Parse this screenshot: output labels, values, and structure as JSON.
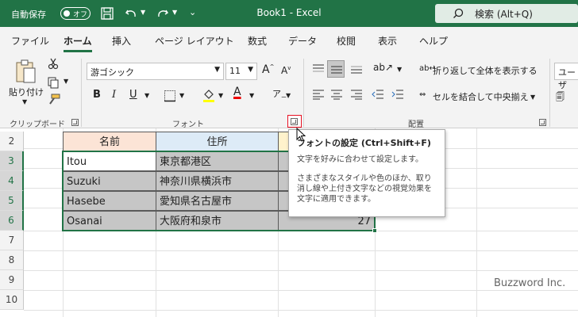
{
  "titlebar": {
    "autosave_label": "自動保存",
    "autosave_state": "オフ",
    "title": "Book1  -  Excel",
    "search_label": "検索 (Alt+Q)"
  },
  "menu": {
    "tabs": [
      "ファイル",
      "ホーム",
      "挿入",
      "ページ レイアウト",
      "数式",
      "データ",
      "校閲",
      "表示",
      "ヘルプ"
    ],
    "active": "ホーム"
  },
  "ribbon": {
    "clipboard": {
      "paste_label": "貼り付け",
      "group_label": "クリップボード"
    },
    "font": {
      "font_name": "游ゴシック",
      "font_size": "11",
      "bold": "B",
      "italic": "I",
      "underline": "U",
      "group_label": "フォント"
    },
    "alignment": {
      "wrap_label": "折り返して全体を表示する",
      "merge_label": "セルを結合して中央揃え",
      "group_label": "配置"
    },
    "number": {
      "format_partial": "ユーザ"
    }
  },
  "sheet": {
    "row_numbers": [
      "2",
      "3",
      "4",
      "5",
      "6",
      "7",
      "8",
      "9",
      "10"
    ],
    "selected_rows": [
      "3",
      "4",
      "5",
      "6"
    ],
    "header": {
      "name": "名前",
      "address": "住所"
    },
    "rows": [
      {
        "name": "Itou",
        "address": "東京都港区",
        "value": ""
      },
      {
        "name": "Suzuki",
        "address": "神奈川県横浜市",
        "value": ""
      },
      {
        "name": "Hasebe",
        "address": "愛知県名古屋市",
        "value": ""
      },
      {
        "name": "Osanai",
        "address": "大阪府和泉市",
        "value": "27"
      }
    ]
  },
  "tooltip": {
    "title": "フォントの設定 (Ctrl+Shift+F)",
    "description": "文字を好みに合わせて設定します。",
    "detail": "さまざまなスタイルや色のほか、取り消し線や上付き文字などの視覚効果を文字に適用できます。"
  },
  "watermark": "Buzzword Inc.",
  "colors": {
    "excel_green": "#217346",
    "header_name_bg": "#fce4d6",
    "header_address_bg": "#ddebf7",
    "launcher_highlight": "#e81123"
  }
}
